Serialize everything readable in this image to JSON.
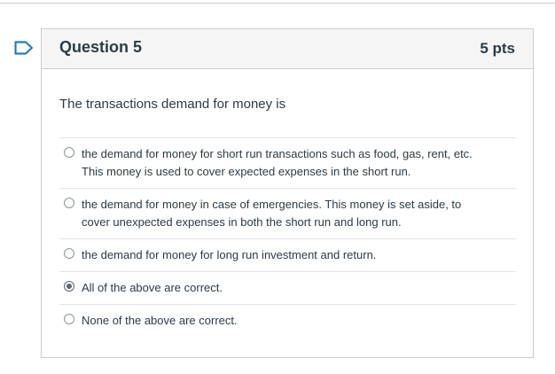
{
  "question": {
    "title": "Question 5",
    "points": "5 pts",
    "text": "The transactions demand for money is"
  },
  "answers": [
    {
      "line1": "the demand for money for short run transactions such as food, gas, rent, etc.",
      "line2": "This money is used to cover expected expenses in the short run.",
      "selected": false
    },
    {
      "line1": "the demand for money in case of emergencies. This money is set aside, to",
      "line2": "cover unexpected expenses in both the short run and long run.",
      "selected": false
    },
    {
      "line1": "the demand for money for long run investment and return.",
      "selected": false
    },
    {
      "line1": "All of the above are correct.",
      "selected": true
    },
    {
      "line1": "None of the above are correct.",
      "selected": false
    }
  ],
  "colors": {
    "flag": "#2d79b8",
    "text": "#2d3b45",
    "border": "#c7cdd1",
    "header_bg": "#f5f5f5"
  },
  "icons": {
    "flag": "bookmark-flag-icon"
  }
}
